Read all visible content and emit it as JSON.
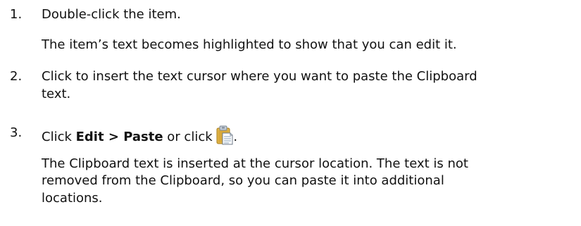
{
  "steps": [
    {
      "number": "1.",
      "instruction": "Double-click the item.",
      "result": "The item’s text becomes highlighted to show that you can edit it."
    },
    {
      "number": "2.",
      "instruction_lines": [
        "Click to insert the text cursor where you want to paste the Clipboard",
        "text."
      ]
    },
    {
      "number": "3.",
      "instruction_prefix": "Click ",
      "menu_path": "Edit > Paste",
      "instruction_middle": " or click ",
      "instruction_suffix": ".",
      "icon": "paste-icon",
      "result_lines": [
        "The Clipboard text is inserted at the cursor location. The text is not",
        "removed from the Clipboard, so you can paste it into additional",
        "locations."
      ]
    }
  ],
  "colors": {
    "text": "#111111",
    "clipboard_body": "#e0b64a",
    "clipboard_edge": "#a87c1c",
    "paper": "#ffffff",
    "clip_metal": "#9aa7b5"
  }
}
